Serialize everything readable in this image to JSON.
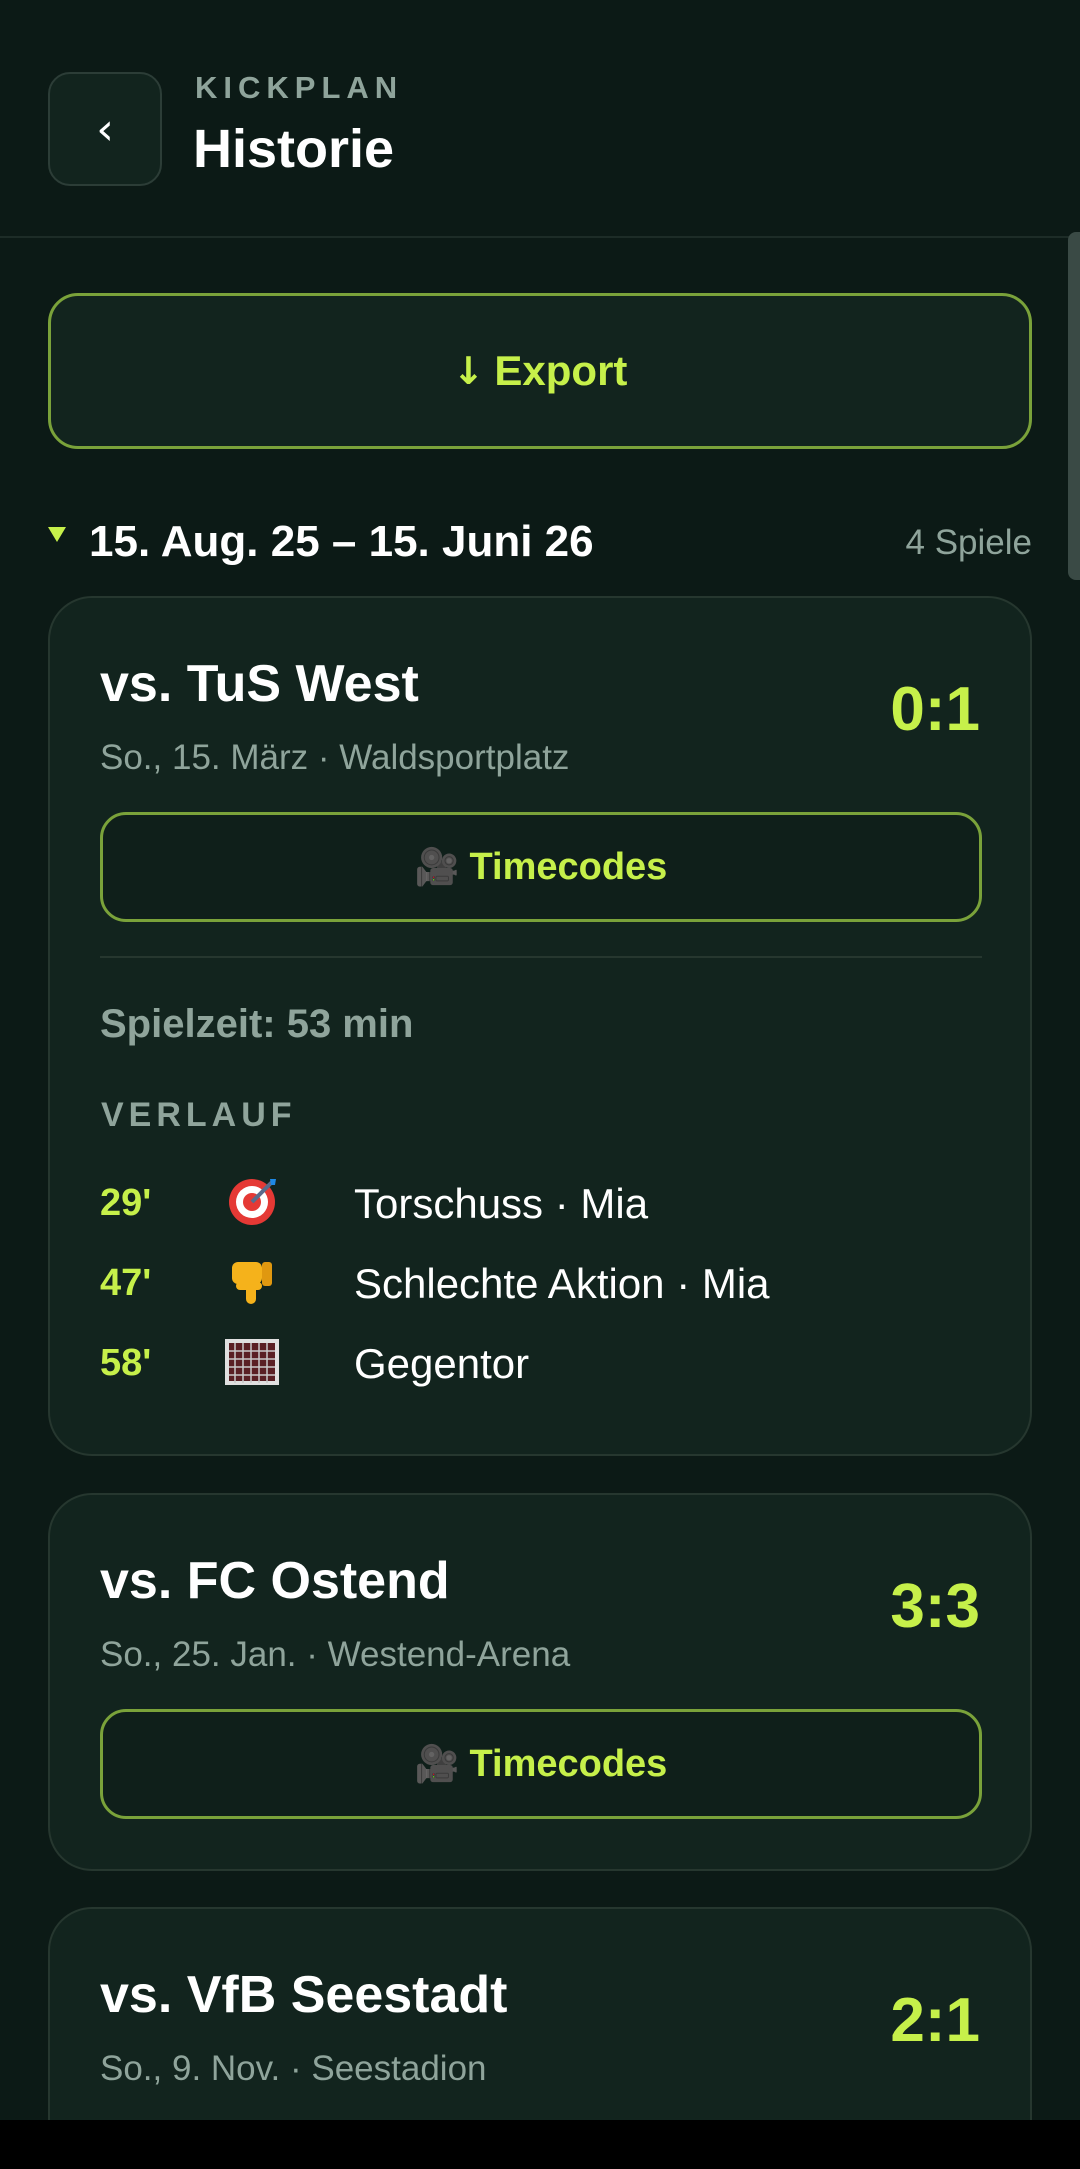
{
  "header": {
    "back_label": "‹",
    "brand": "KICKPLAN",
    "title": "Historie"
  },
  "export": {
    "arrow": "↓",
    "label": "Export"
  },
  "season": {
    "label": "15. Aug. 25 – 15. Juni 26",
    "count": "4 Spiele"
  },
  "matches": [
    {
      "opponent": "vs. TuS West",
      "score": "0:1",
      "meta": "So., 15. März · Waldsportplatz",
      "timecodes_label": "Timecodes",
      "timecodes_icon": "🎥",
      "playtime": "Spielzeit: 53 min",
      "section_label": "VERLAUF",
      "events": [
        {
          "minute": "29'",
          "icon": "target-icon",
          "text": "Torschuss · Mia"
        },
        {
          "minute": "47'",
          "icon": "thumbs-down-icon",
          "text": "Schlechte Aktion · Mia"
        },
        {
          "minute": "58'",
          "icon": "goal-net-icon",
          "text": "Gegentor"
        }
      ]
    },
    {
      "opponent": "vs. FC Ostend",
      "score": "3:3",
      "meta": "So., 25. Jan. · Westend-Arena",
      "timecodes_label": "Timecodes",
      "timecodes_icon": "🎥"
    },
    {
      "opponent": "vs. VfB Seestadt",
      "score": "2:1",
      "meta": "So., 9. Nov. · Seestadion"
    }
  ],
  "colors": {
    "background": "#0c1a16",
    "card": "#12241e",
    "accent": "#c6f04a",
    "muted": "#8fa49b",
    "border_accent": "#7aa23a"
  }
}
